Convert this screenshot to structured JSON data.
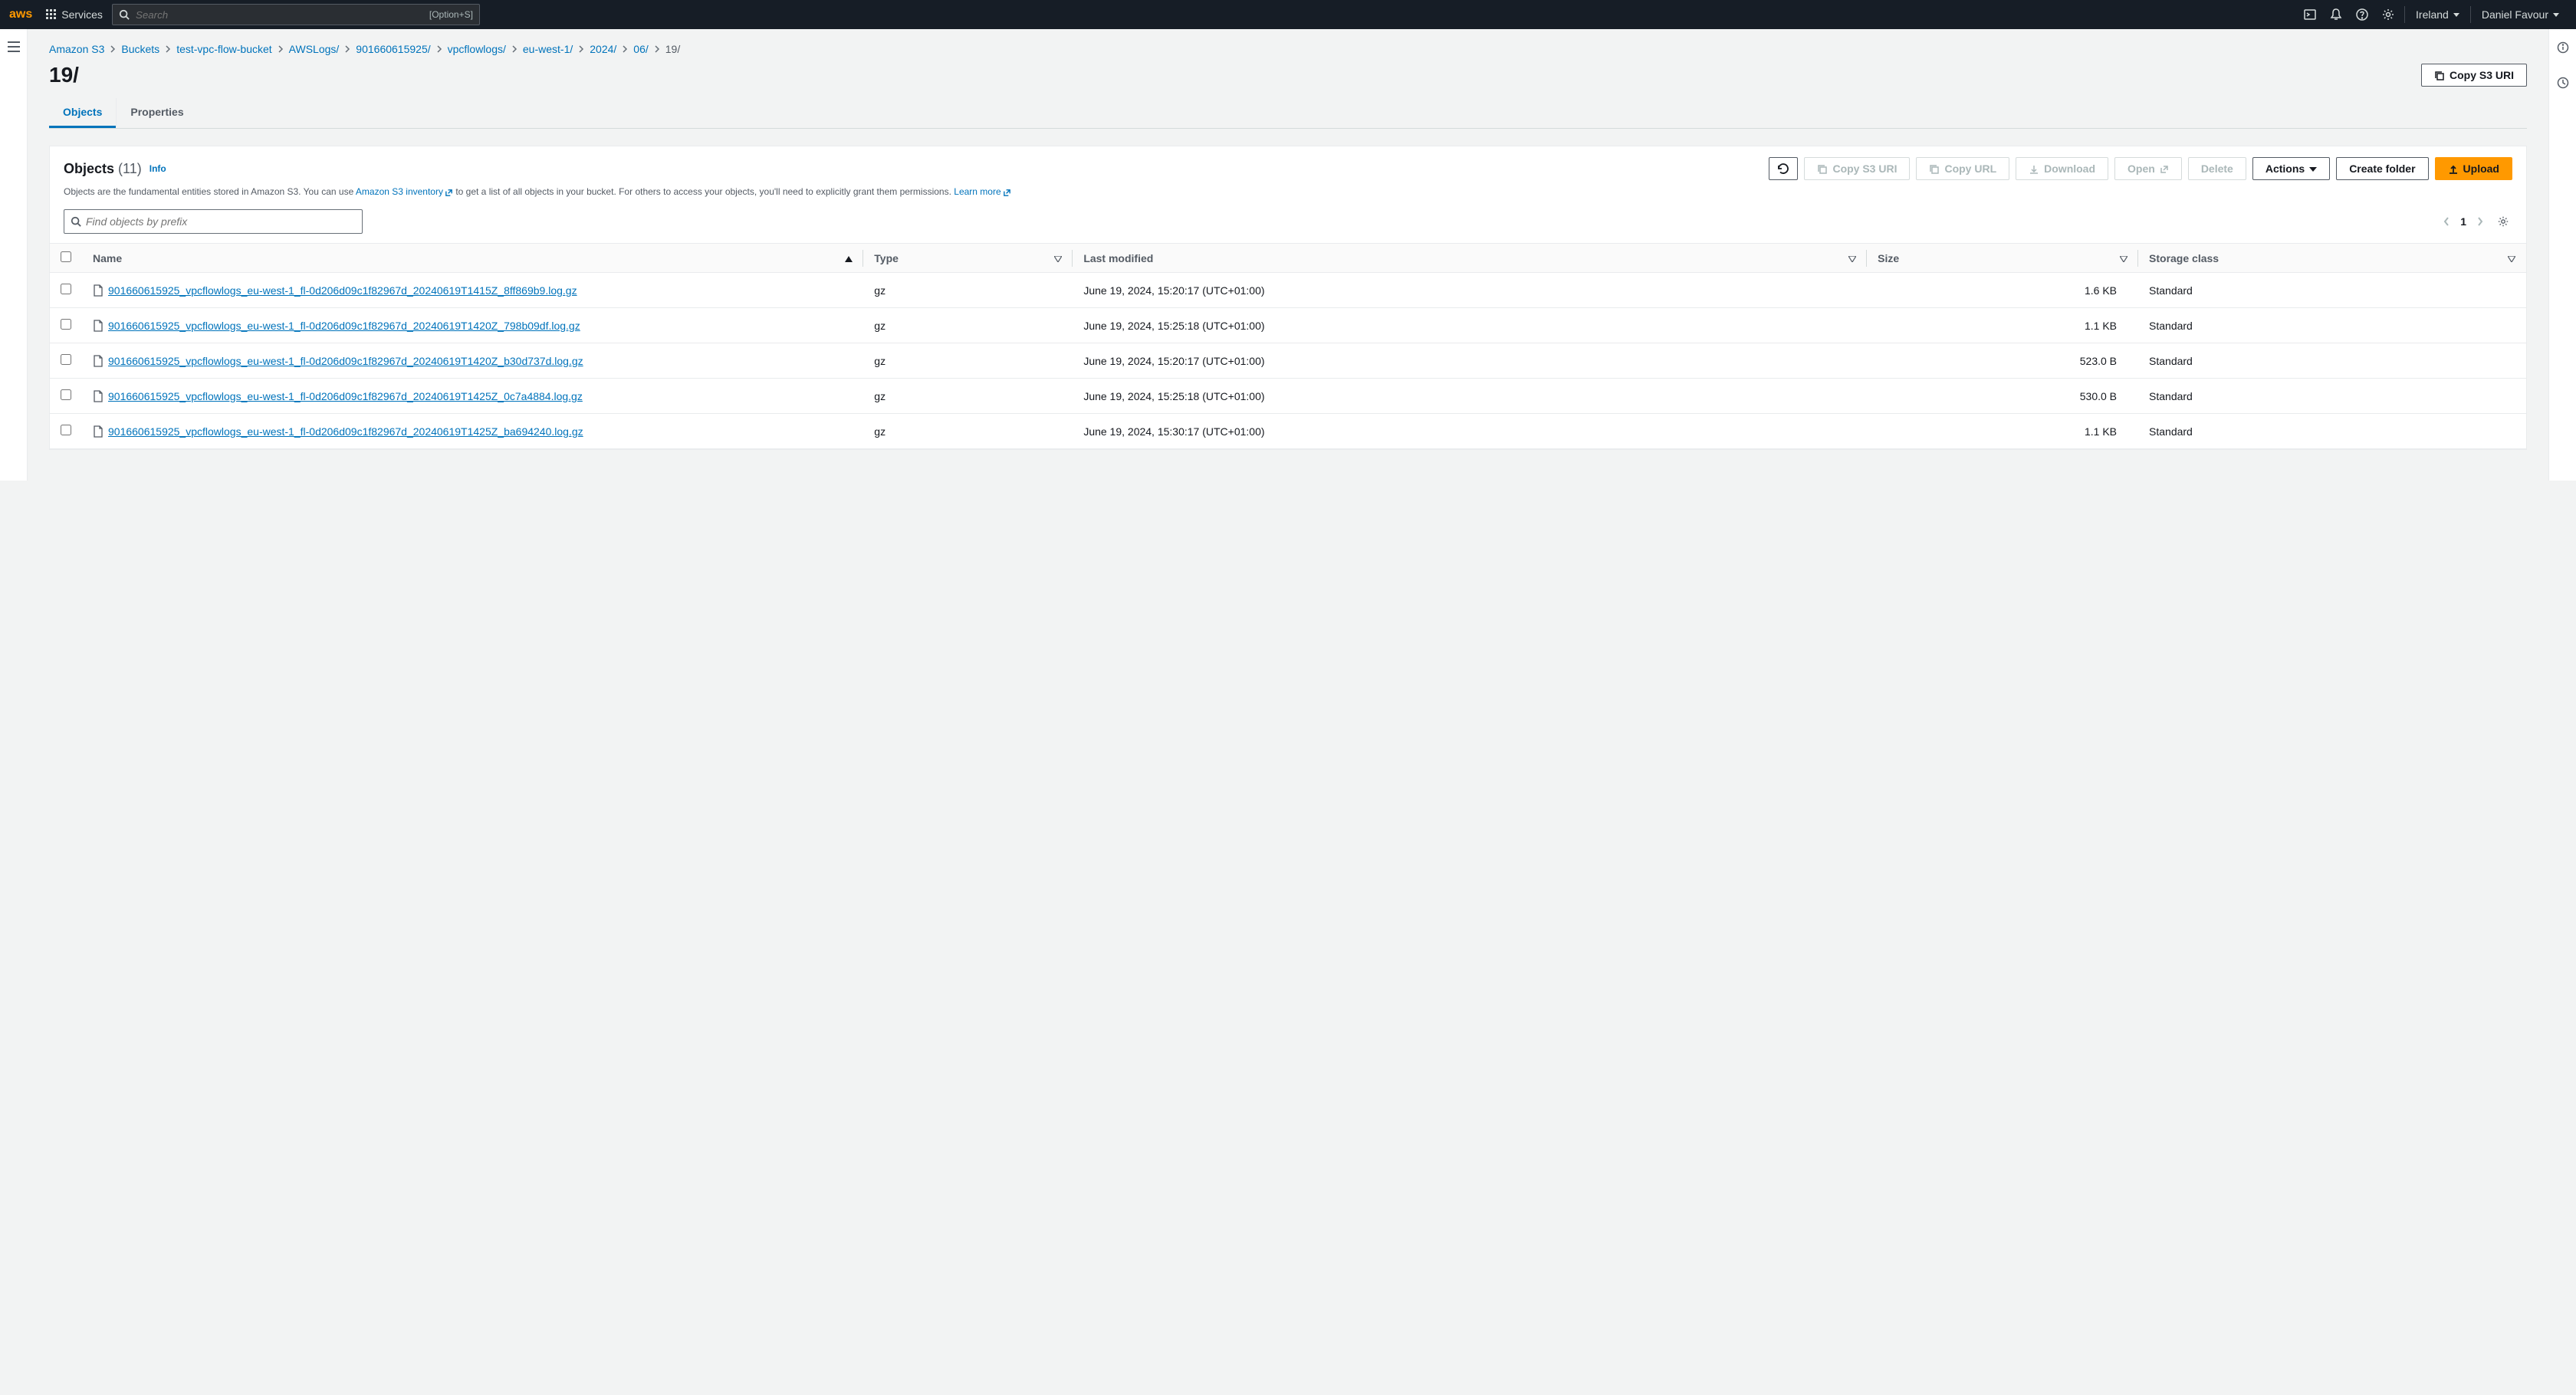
{
  "topnav": {
    "services_label": "Services",
    "search_placeholder": "Search",
    "search_shortcut": "[Option+S]",
    "region": "Ireland",
    "user": "Daniel Favour"
  },
  "breadcrumb": [
    "Amazon S3",
    "Buckets",
    "test-vpc-flow-bucket",
    "AWSLogs/",
    "901660615925/",
    "vpcflowlogs/",
    "eu-west-1/",
    "2024/",
    "06/"
  ],
  "breadcrumb_current": "19/",
  "page_title": "19/",
  "copy_s3_uri_btn": "Copy S3 URI",
  "tabs": {
    "objects": "Objects",
    "properties": "Properties"
  },
  "panel": {
    "title": "Objects",
    "count": "(11)",
    "info": "Info",
    "toolbar": {
      "copy_s3_uri": "Copy S3 URI",
      "copy_url": "Copy URL",
      "download": "Download",
      "open": "Open",
      "delete": "Delete",
      "actions": "Actions",
      "create_folder": "Create folder",
      "upload": "Upload"
    },
    "desc_prefix": "Objects are the fundamental entities stored in Amazon S3. You can use ",
    "desc_link1": "Amazon S3 inventory",
    "desc_mid": " to get a list of all objects in your bucket. For others to access your objects, you'll need to explicitly grant them permissions. ",
    "desc_link2": "Learn more",
    "find_placeholder": "Find objects by prefix",
    "page_number": "1"
  },
  "columns": {
    "name": "Name",
    "type": "Type",
    "last_modified": "Last modified",
    "size": "Size",
    "storage_class": "Storage class"
  },
  "rows": [
    {
      "name": "901660615925_vpcflowlogs_eu-west-1_fl-0d206d09c1f82967d_20240619T1415Z_8ff869b9.log.gz",
      "type": "gz",
      "modified": "June 19, 2024, 15:20:17 (UTC+01:00)",
      "size": "1.6 KB",
      "storage": "Standard"
    },
    {
      "name": "901660615925_vpcflowlogs_eu-west-1_fl-0d206d09c1f82967d_20240619T1420Z_798b09df.log.gz",
      "type": "gz",
      "modified": "June 19, 2024, 15:25:18 (UTC+01:00)",
      "size": "1.1 KB",
      "storage": "Standard"
    },
    {
      "name": "901660615925_vpcflowlogs_eu-west-1_fl-0d206d09c1f82967d_20240619T1420Z_b30d737d.log.gz",
      "type": "gz",
      "modified": "June 19, 2024, 15:20:17 (UTC+01:00)",
      "size": "523.0 B",
      "storage": "Standard"
    },
    {
      "name": "901660615925_vpcflowlogs_eu-west-1_fl-0d206d09c1f82967d_20240619T1425Z_0c7a4884.log.gz",
      "type": "gz",
      "modified": "June 19, 2024, 15:25:18 (UTC+01:00)",
      "size": "530.0 B",
      "storage": "Standard"
    },
    {
      "name": "901660615925_vpcflowlogs_eu-west-1_fl-0d206d09c1f82967d_20240619T1425Z_ba694240.log.gz",
      "type": "gz",
      "modified": "June 19, 2024, 15:30:17 (UTC+01:00)",
      "size": "1.1 KB",
      "storage": "Standard"
    }
  ]
}
